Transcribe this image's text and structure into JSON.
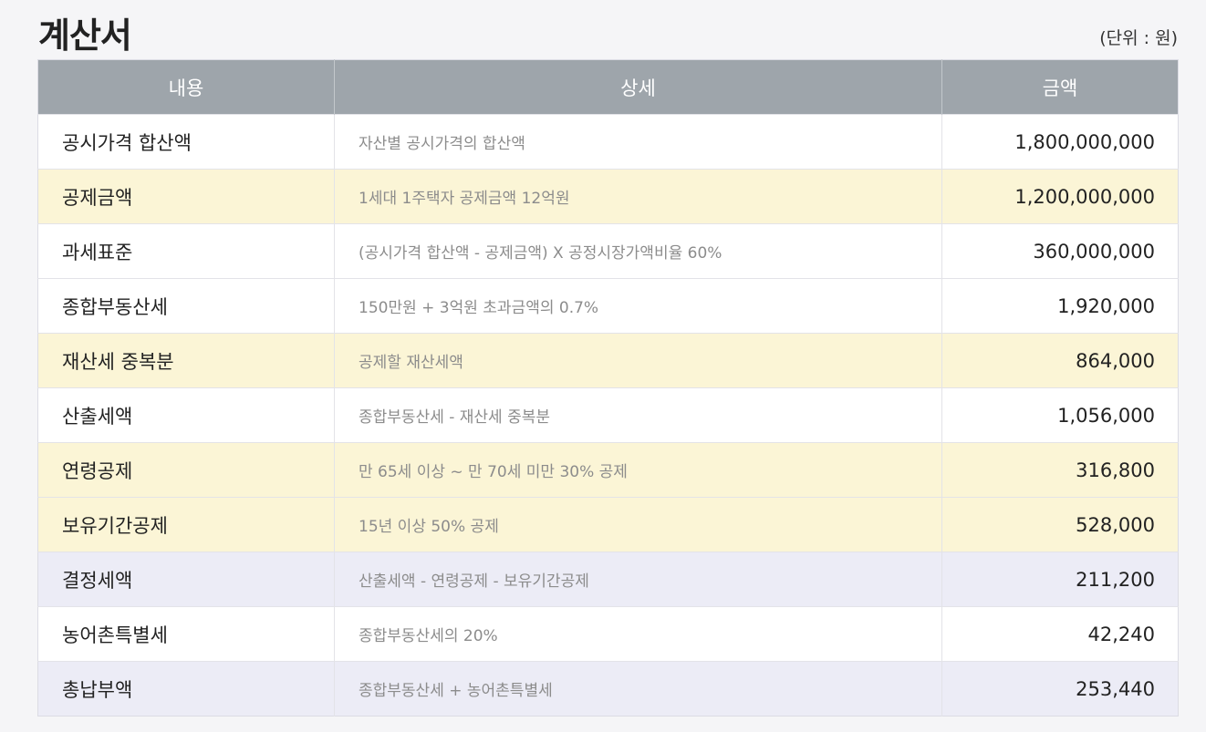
{
  "page": {
    "title": "계산서",
    "unit": "(단위 : 원)"
  },
  "table": {
    "headers": [
      "내용",
      "상세",
      "금액"
    ],
    "rows": [
      {
        "label": "공시가격 합산액",
        "detail": "자산별 공시가격의 합산액",
        "amount": "1,800,000,000",
        "style": "white"
      },
      {
        "label": "공제금액",
        "detail": "1세대 1주택자 공제금액 12억원",
        "amount": "1,200,000,000",
        "style": "yellow"
      },
      {
        "label": "과세표준",
        "detail": "(공시가격 합산액 - 공제금액) X 공정시장가액비율 60%",
        "amount": "360,000,000",
        "style": "white"
      },
      {
        "label": "종합부동산세",
        "detail": "150만원 + 3억원 초과금액의 0.7%",
        "amount": "1,920,000",
        "style": "white"
      },
      {
        "label": "재산세 중복분",
        "detail": "공제할 재산세액",
        "amount": "864,000",
        "style": "yellow"
      },
      {
        "label": "산출세액",
        "detail": "종합부동산세 - 재산세 중복분",
        "amount": "1,056,000",
        "style": "white"
      },
      {
        "label": "연령공제",
        "detail": "만 65세 이상 ~ 만 70세 미만 30% 공제",
        "amount": "316,800",
        "style": "yellow"
      },
      {
        "label": "보유기간공제",
        "detail": "15년 이상 50% 공제",
        "amount": "528,000",
        "style": "yellow"
      },
      {
        "label": "결정세액",
        "detail": "산출세액 - 연령공제 - 보유기간공제",
        "amount": "211,200",
        "style": "lavender"
      },
      {
        "label": "농어촌특별세",
        "detail": "종합부동산세의 20%",
        "amount": "42,240",
        "style": "white"
      },
      {
        "label": "총납부액",
        "detail": "종합부동산세 + 농어촌특별세",
        "amount": "253,440",
        "style": "lavender"
      }
    ]
  },
  "colors": {
    "background": "#f5f5f7",
    "header_bg": "#9ea5ab",
    "row_white": "#ffffff",
    "row_yellow": "#fbf5d6",
    "row_lavender": "#ececf6",
    "detail_text": "#8c8c8c"
  }
}
